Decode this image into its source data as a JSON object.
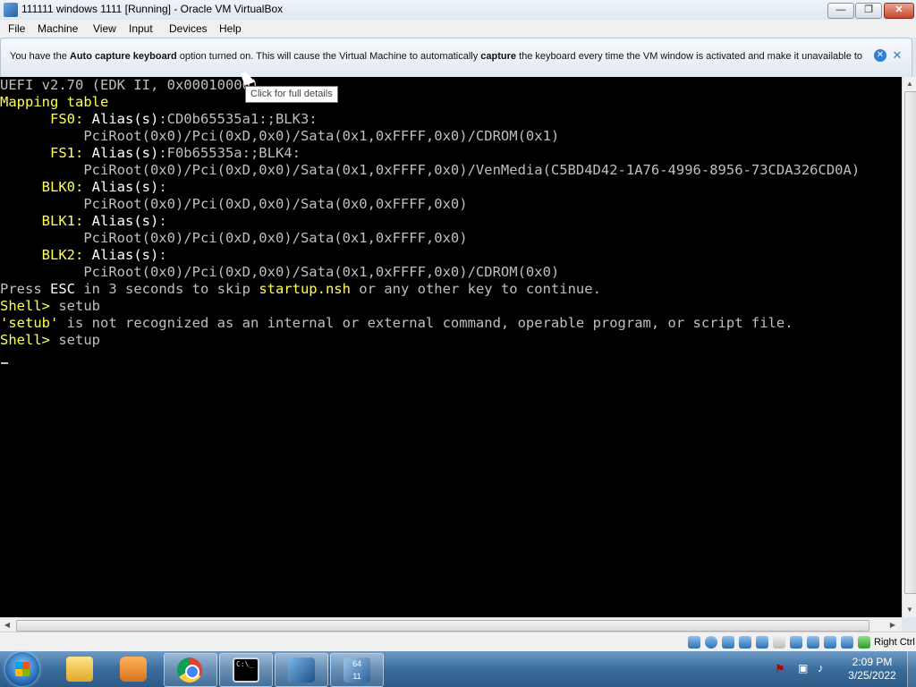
{
  "window": {
    "title": "111111 windows 1111 [Running] - Oracle VM VirtualBox",
    "minimize_glyph": "—",
    "maximize_glyph": "❐",
    "close_glyph": "✕"
  },
  "menu": [
    "File",
    "Machine",
    "View",
    "Input",
    "Devices",
    "Help"
  ],
  "notification": {
    "text_prefix": "You have the ",
    "bold1": "Auto capture keyboard",
    "text_mid": " option turned on. This will cause the Virtual Machine to automatically ",
    "bold2": "capture",
    "text_suffix": " the keyboard every time the VM window is activated and make it unavailable to",
    "close_glyph": "✕",
    "hide_glyph": "✕"
  },
  "tooltip": "Click for full details",
  "console": {
    "lines": [
      {
        "parts": [
          {
            "t": "UEFI v2.70 (EDK II, 0x00010000)",
            "c": "g"
          }
        ]
      },
      {
        "parts": [
          {
            "t": "Mapping table",
            "c": "y"
          }
        ]
      },
      {
        "parts": [
          {
            "t": "      FS0: ",
            "c": "y"
          },
          {
            "t": "Alias(s)",
            "c": "w"
          },
          {
            "t": ":CD0b65535a1:;BLK3:",
            "c": "g"
          }
        ]
      },
      {
        "parts": [
          {
            "t": "          PciRoot(0x0)/Pci(0xD,0x0)/Sata(0x1,0xFFFF,0x0)/CDROM(0x1)",
            "c": "g"
          }
        ]
      },
      {
        "parts": [
          {
            "t": "      FS1: ",
            "c": "y"
          },
          {
            "t": "Alias(s)",
            "c": "w"
          },
          {
            "t": ":F0b65535a:;BLK4:",
            "c": "g"
          }
        ]
      },
      {
        "parts": [
          {
            "t": "          PciRoot(0x0)/Pci(0xD,0x0)/Sata(0x1,0xFFFF,0x0)/VenMedia(C5BD4D42-1A76-4996-8956-73CDA326CD0A)",
            "c": "g"
          }
        ]
      },
      {
        "parts": [
          {
            "t": "     BLK0: ",
            "c": "y"
          },
          {
            "t": "Alias(s)",
            "c": "w"
          },
          {
            "t": ":",
            "c": "g"
          }
        ]
      },
      {
        "parts": [
          {
            "t": "          PciRoot(0x0)/Pci(0xD,0x0)/Sata(0x0,0xFFFF,0x0)",
            "c": "g"
          }
        ]
      },
      {
        "parts": [
          {
            "t": "     BLK1: ",
            "c": "y"
          },
          {
            "t": "Alias(s)",
            "c": "w"
          },
          {
            "t": ":",
            "c": "g"
          }
        ]
      },
      {
        "parts": [
          {
            "t": "          PciRoot(0x0)/Pci(0xD,0x0)/Sata(0x1,0xFFFF,0x0)",
            "c": "g"
          }
        ]
      },
      {
        "parts": [
          {
            "t": "     BLK2: ",
            "c": "y"
          },
          {
            "t": "Alias(s)",
            "c": "w"
          },
          {
            "t": ":",
            "c": "g"
          }
        ]
      },
      {
        "parts": [
          {
            "t": "          PciRoot(0x0)/Pci(0xD,0x0)/Sata(0x1,0xFFFF,0x0)/CDROM(0x0)",
            "c": "g"
          }
        ]
      },
      {
        "parts": [
          {
            "t": "Press ",
            "c": "g"
          },
          {
            "t": "ESC",
            "c": "w"
          },
          {
            "t": " in 3 seconds to skip ",
            "c": "g"
          },
          {
            "t": "startup.nsh",
            "c": "y"
          },
          {
            "t": " or any other key to continue.",
            "c": "g"
          }
        ]
      },
      {
        "parts": [
          {
            "t": "Shell> ",
            "c": "y"
          },
          {
            "t": "setub",
            "c": "g"
          }
        ]
      },
      {
        "parts": [
          {
            "t": "'setub'",
            "c": "y"
          },
          {
            "t": " is not recognized as an internal or external command, operable program, or script file.",
            "c": "g"
          }
        ]
      },
      {
        "parts": [
          {
            "t": "Shell> ",
            "c": "y"
          },
          {
            "t": "setup",
            "c": "g"
          }
        ]
      }
    ]
  },
  "statusbar": {
    "host_key": "Right Ctrl",
    "icons": [
      "hard-disk-icon",
      "optical-drive-icon",
      "audio-icon",
      "network-icon",
      "usb-icon",
      "shared-folders-icon",
      "display-icon",
      "recording-icon",
      "mouse-integration-icon",
      "cpu-icon",
      "guest-additions-icon"
    ]
  },
  "taskbar": {
    "vm_badge": "64",
    "vm_badge_sub": "11",
    "cmd_glyph": "C:\\_",
    "time": "2:09 PM",
    "date": "3/25/2022"
  },
  "colors": {
    "console_bg": "#000000",
    "console_text": "#bfbfbf",
    "console_yellow": "#ffff55",
    "console_white": "#ffffff",
    "taskbar": "#3a6c9c"
  }
}
